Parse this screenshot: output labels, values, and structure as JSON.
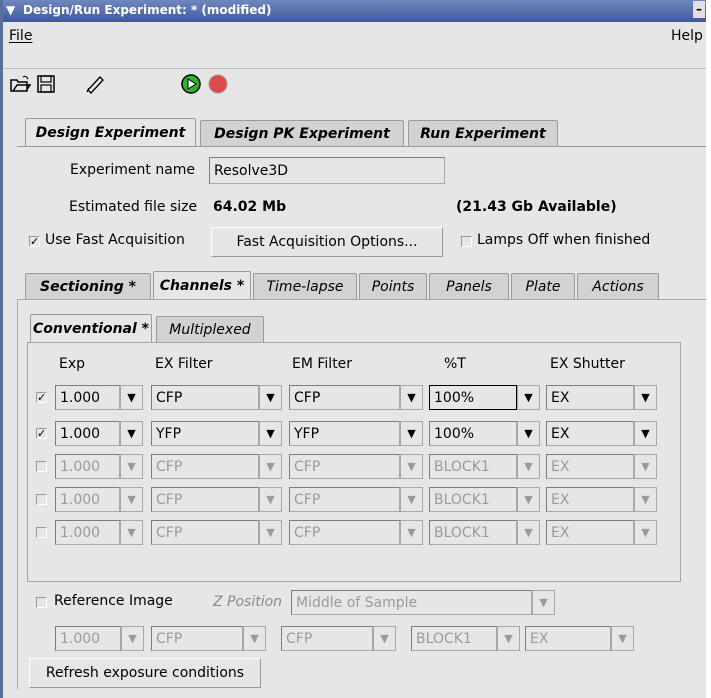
{
  "window": {
    "title": "Design/Run Experiment: * (modified)"
  },
  "menubar": {
    "file": "File",
    "help": "Help"
  },
  "toolbar": {
    "icons": [
      "open-folder-icon",
      "save-icon",
      "edit-icon",
      "run-icon",
      "stop-icon"
    ]
  },
  "main_tabs": [
    {
      "label": "Design Experiment",
      "selected": true
    },
    {
      "label": "Design PK Experiment"
    },
    {
      "label": "Run Experiment"
    }
  ],
  "experiment": {
    "name_label": "Experiment name",
    "name_value": "Resolve3D",
    "size_label": "Estimated file size",
    "size_value": "64.02 Mb",
    "available": "(21.43 Gb Available)"
  },
  "fast_acq": {
    "checkbox_label": "Use Fast Acquisition",
    "checked": true,
    "options_button": "Fast Acquisition Options...",
    "lamps_label": "Lamps Off when finished",
    "lamps_checked": false
  },
  "sub_tabs": [
    {
      "label": "Sectioning *"
    },
    {
      "label": "Channels *",
      "selected": true
    },
    {
      "label": "Time-lapse"
    },
    {
      "label": "Points"
    },
    {
      "label": "Panels"
    },
    {
      "label": "Plate"
    },
    {
      "label": "Actions"
    }
  ],
  "channel_tabs": [
    {
      "label": "Conventional *",
      "selected": true
    },
    {
      "label": "Multiplexed"
    }
  ],
  "channels": {
    "headers": {
      "exp": "Exp",
      "ex": "EX Filter",
      "em": "EM Filter",
      "t": "%T",
      "shutter": "EX Shutter"
    },
    "rows": [
      {
        "checked": true,
        "exp": "1.000",
        "ex": "CFP",
        "em": "CFP",
        "t": "100%",
        "shutter": "EX"
      },
      {
        "checked": true,
        "exp": "1.000",
        "ex": "YFP",
        "em": "YFP",
        "t": "100%",
        "shutter": "EX"
      },
      {
        "checked": false,
        "exp": "1.000",
        "ex": "CFP",
        "em": "CFP",
        "t": "BLOCK1",
        "shutter": "EX"
      },
      {
        "checked": false,
        "exp": "1.000",
        "ex": "CFP",
        "em": "CFP",
        "t": "BLOCK1",
        "shutter": "EX"
      },
      {
        "checked": false,
        "exp": "1.000",
        "ex": "CFP",
        "em": "CFP",
        "t": "BLOCK1",
        "shutter": "EX"
      }
    ]
  },
  "reference": {
    "label": "Reference Image",
    "checked": false,
    "zpos_label": "Z Position",
    "zpos_value": "Middle of Sample",
    "exp": "1.000",
    "ex": "CFP",
    "em": "CFP",
    "t": "BLOCK1",
    "shutter": "EX"
  },
  "refresh_button": "Refresh exposure conditions",
  "colors": {
    "titlebar": "#3d5a9c",
    "run_green": "#2bb52b",
    "stop_red": "#e04a4a"
  }
}
